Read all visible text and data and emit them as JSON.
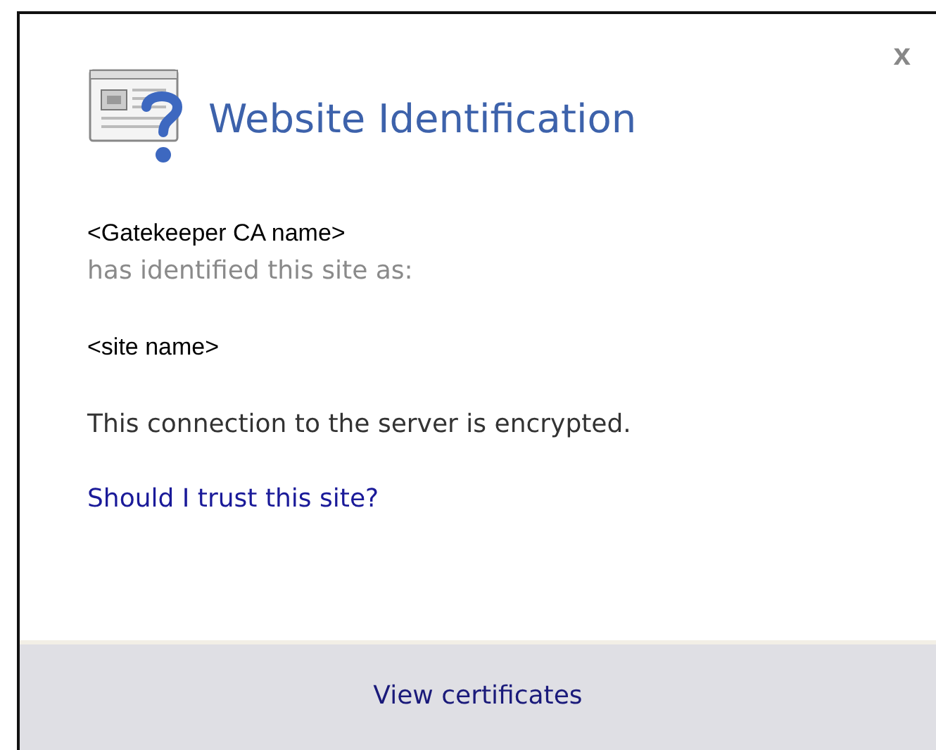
{
  "dialog": {
    "title": "Website Identification",
    "close": "x",
    "issuer": "<Gatekeeper CA name>",
    "identified_text": "has identified this site as:",
    "site": "<site name>",
    "connection_text": "This connection to the server is encrypted.",
    "trust_link": "Should I trust this site?",
    "footer_button": "View certificates"
  }
}
